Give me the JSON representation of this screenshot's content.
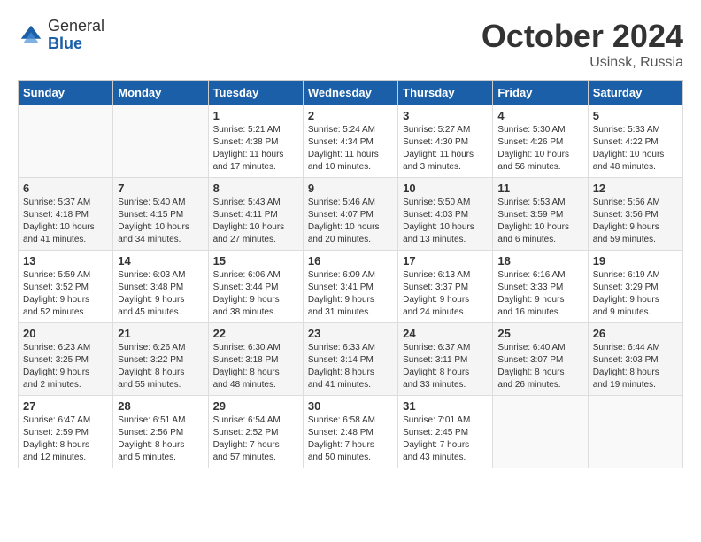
{
  "header": {
    "logo_general": "General",
    "logo_blue": "Blue",
    "month": "October 2024",
    "location": "Usinsk, Russia"
  },
  "weekdays": [
    "Sunday",
    "Monday",
    "Tuesday",
    "Wednesday",
    "Thursday",
    "Friday",
    "Saturday"
  ],
  "weeks": [
    [
      {
        "day": "",
        "content": ""
      },
      {
        "day": "",
        "content": ""
      },
      {
        "day": "1",
        "content": "Sunrise: 5:21 AM\nSunset: 4:38 PM\nDaylight: 11 hours\nand 17 minutes."
      },
      {
        "day": "2",
        "content": "Sunrise: 5:24 AM\nSunset: 4:34 PM\nDaylight: 11 hours\nand 10 minutes."
      },
      {
        "day": "3",
        "content": "Sunrise: 5:27 AM\nSunset: 4:30 PM\nDaylight: 11 hours\nand 3 minutes."
      },
      {
        "day": "4",
        "content": "Sunrise: 5:30 AM\nSunset: 4:26 PM\nDaylight: 10 hours\nand 56 minutes."
      },
      {
        "day": "5",
        "content": "Sunrise: 5:33 AM\nSunset: 4:22 PM\nDaylight: 10 hours\nand 48 minutes."
      }
    ],
    [
      {
        "day": "6",
        "content": "Sunrise: 5:37 AM\nSunset: 4:18 PM\nDaylight: 10 hours\nand 41 minutes."
      },
      {
        "day": "7",
        "content": "Sunrise: 5:40 AM\nSunset: 4:15 PM\nDaylight: 10 hours\nand 34 minutes."
      },
      {
        "day": "8",
        "content": "Sunrise: 5:43 AM\nSunset: 4:11 PM\nDaylight: 10 hours\nand 27 minutes."
      },
      {
        "day": "9",
        "content": "Sunrise: 5:46 AM\nSunset: 4:07 PM\nDaylight: 10 hours\nand 20 minutes."
      },
      {
        "day": "10",
        "content": "Sunrise: 5:50 AM\nSunset: 4:03 PM\nDaylight: 10 hours\nand 13 minutes."
      },
      {
        "day": "11",
        "content": "Sunrise: 5:53 AM\nSunset: 3:59 PM\nDaylight: 10 hours\nand 6 minutes."
      },
      {
        "day": "12",
        "content": "Sunrise: 5:56 AM\nSunset: 3:56 PM\nDaylight: 9 hours\nand 59 minutes."
      }
    ],
    [
      {
        "day": "13",
        "content": "Sunrise: 5:59 AM\nSunset: 3:52 PM\nDaylight: 9 hours\nand 52 minutes."
      },
      {
        "day": "14",
        "content": "Sunrise: 6:03 AM\nSunset: 3:48 PM\nDaylight: 9 hours\nand 45 minutes."
      },
      {
        "day": "15",
        "content": "Sunrise: 6:06 AM\nSunset: 3:44 PM\nDaylight: 9 hours\nand 38 minutes."
      },
      {
        "day": "16",
        "content": "Sunrise: 6:09 AM\nSunset: 3:41 PM\nDaylight: 9 hours\nand 31 minutes."
      },
      {
        "day": "17",
        "content": "Sunrise: 6:13 AM\nSunset: 3:37 PM\nDaylight: 9 hours\nand 24 minutes."
      },
      {
        "day": "18",
        "content": "Sunrise: 6:16 AM\nSunset: 3:33 PM\nDaylight: 9 hours\nand 16 minutes."
      },
      {
        "day": "19",
        "content": "Sunrise: 6:19 AM\nSunset: 3:29 PM\nDaylight: 9 hours\nand 9 minutes."
      }
    ],
    [
      {
        "day": "20",
        "content": "Sunrise: 6:23 AM\nSunset: 3:25 PM\nDaylight: 9 hours\nand 2 minutes."
      },
      {
        "day": "21",
        "content": "Sunrise: 6:26 AM\nSunset: 3:22 PM\nDaylight: 8 hours\nand 55 minutes."
      },
      {
        "day": "22",
        "content": "Sunrise: 6:30 AM\nSunset: 3:18 PM\nDaylight: 8 hours\nand 48 minutes."
      },
      {
        "day": "23",
        "content": "Sunrise: 6:33 AM\nSunset: 3:14 PM\nDaylight: 8 hours\nand 41 minutes."
      },
      {
        "day": "24",
        "content": "Sunrise: 6:37 AM\nSunset: 3:11 PM\nDaylight: 8 hours\nand 33 minutes."
      },
      {
        "day": "25",
        "content": "Sunrise: 6:40 AM\nSunset: 3:07 PM\nDaylight: 8 hours\nand 26 minutes."
      },
      {
        "day": "26",
        "content": "Sunrise: 6:44 AM\nSunset: 3:03 PM\nDaylight: 8 hours\nand 19 minutes."
      }
    ],
    [
      {
        "day": "27",
        "content": "Sunrise: 6:47 AM\nSunset: 2:59 PM\nDaylight: 8 hours\nand 12 minutes."
      },
      {
        "day": "28",
        "content": "Sunrise: 6:51 AM\nSunset: 2:56 PM\nDaylight: 8 hours\nand 5 minutes."
      },
      {
        "day": "29",
        "content": "Sunrise: 6:54 AM\nSunset: 2:52 PM\nDaylight: 7 hours\nand 57 minutes."
      },
      {
        "day": "30",
        "content": "Sunrise: 6:58 AM\nSunset: 2:48 PM\nDaylight: 7 hours\nand 50 minutes."
      },
      {
        "day": "31",
        "content": "Sunrise: 7:01 AM\nSunset: 2:45 PM\nDaylight: 7 hours\nand 43 minutes."
      },
      {
        "day": "",
        "content": ""
      },
      {
        "day": "",
        "content": ""
      }
    ]
  ]
}
